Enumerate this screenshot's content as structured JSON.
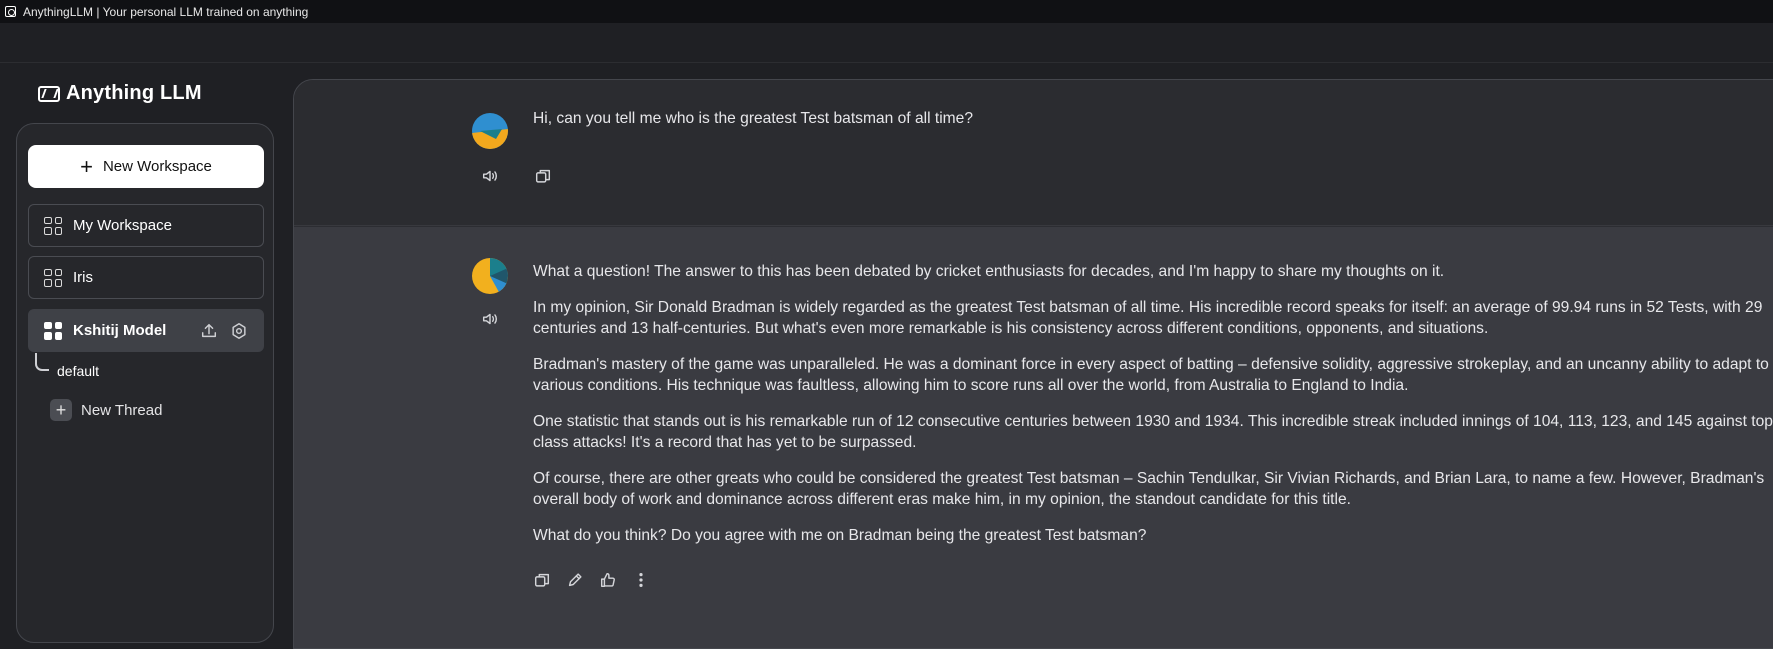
{
  "window": {
    "title": "AnythingLLM | Your personal LLM trained on anything"
  },
  "logo": {
    "text": "Anything LLM"
  },
  "sidebar": {
    "new_workspace_label": "New Workspace",
    "workspaces": [
      {
        "label": "My Workspace"
      },
      {
        "label": "Iris"
      },
      {
        "label": "Kshitij Model"
      }
    ],
    "thread_default": "default",
    "new_thread_label": "New Thread"
  },
  "chat": {
    "user_message": "Hi, can you tell me who is the greatest Test batsman of all time?",
    "assistant_paragraphs": [
      "What a question! The answer to this has been debated by cricket enthusiasts for decades, and I'm happy to share my thoughts on it.",
      "In my opinion, Sir Donald Bradman is widely regarded as the greatest Test batsman of all time. His incredible record speaks for itself: an average of 99.94 runs in 52 Tests, with 29 centuries and 13 half-centuries. But what's even more remarkable is his consistency across different conditions, opponents, and situations.",
      "Bradman's mastery of the game was unparalleled. He was a dominant force in every aspect of batting – defensive solidity, aggressive strokeplay, and an uncanny ability to adapt to various conditions. His technique was faultless, allowing him to score runs all over the world, from Australia to England to India.",
      "One statistic that stands out is his remarkable run of 12 consecutive centuries between 1930 and 1934. This incredible streak included innings of 104, 113, 123, and 145 against top-class attacks! It's a record that has yet to be surpassed.",
      "Of course, there are other greats who could be considered the greatest Test batsman – Sachin Tendulkar, Sir Vivian Richards, and Brian Lara, to name a few. However, Bradman's overall body of work and dominance across different eras make him, in my opinion, the standout candidate for this title.",
      "What do you think? Do you agree with me on Bradman being the greatest Test batsman?"
    ]
  },
  "colors": {
    "user_avatar_top": "#2f8fd0",
    "user_avatar_bottom": "#f2a81d",
    "ai_avatar_yellow": "#f2b01e",
    "ai_avatar_teal": "#1b7f8c"
  }
}
